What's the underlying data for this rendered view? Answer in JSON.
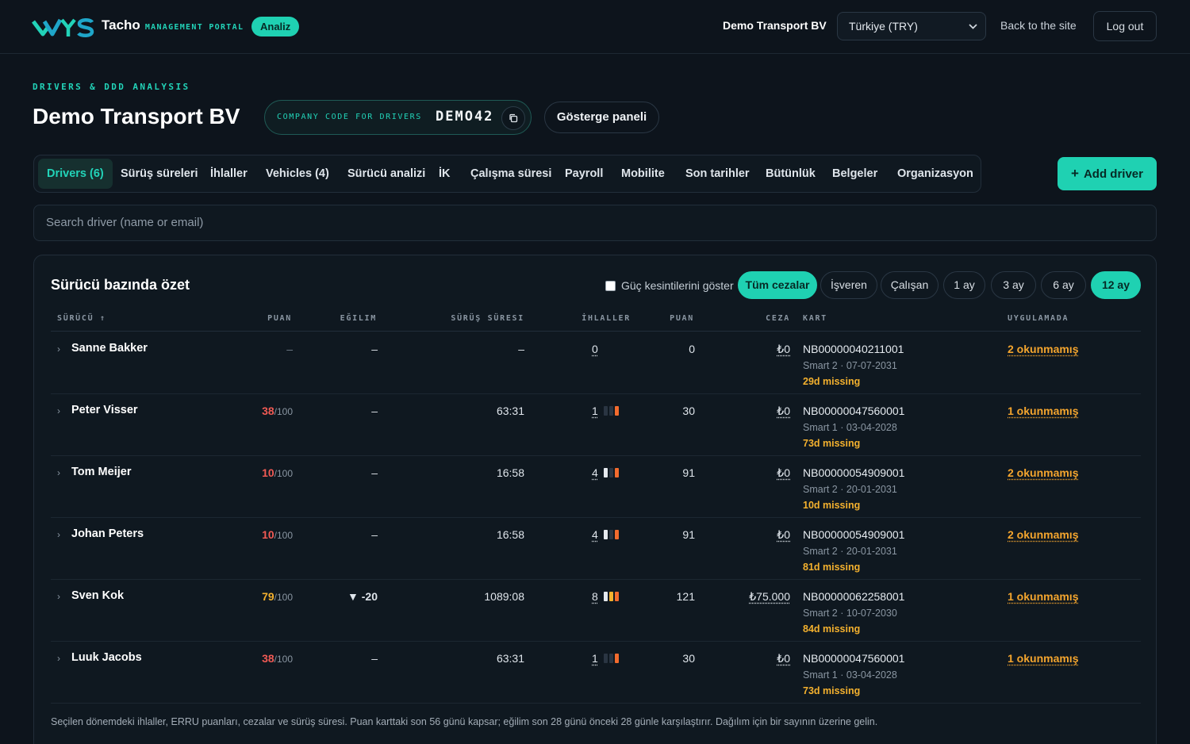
{
  "app": {
    "logo_text": "VYS",
    "brand_main": "Tacho",
    "brand_sub": "MANAGEMENT PORTAL",
    "badge": "Analiz",
    "company": "Demo Transport BV",
    "currency": "Türkiye (TRY)",
    "back_link": "Back to the site",
    "logout": "Log out"
  },
  "header": {
    "kicker": "DRIVERS & DDD ANALYSIS",
    "title": "Demo Transport BV",
    "code_label": "COMPANY CODE FOR DRIVERS",
    "code_value": "DEMO42",
    "dashboard_button": "Gösterge paneli"
  },
  "tabs": [
    {
      "label": "Drivers (6)"
    },
    {
      "label": "Sürüş süreleri"
    },
    {
      "label": "İhlaller"
    },
    {
      "label": "Vehicles (4)"
    },
    {
      "label": "Sürücü analizi"
    },
    {
      "label": "İK"
    },
    {
      "label": "Çalışma süresi"
    },
    {
      "label": "Payroll"
    },
    {
      "label": "Mobilite"
    },
    {
      "label": "Son tarihler"
    },
    {
      "label": "Bütünlük"
    },
    {
      "label": "Belgeler"
    },
    {
      "label": "Organizasyon"
    }
  ],
  "add_driver": "Add driver",
  "search": {
    "placeholder": "Search driver (name or email)"
  },
  "summary": {
    "title": "Sürücü bazında özet",
    "power_checkbox": "Güç kesintilerini göster",
    "filters": [
      "Tüm cezalar",
      "İşveren",
      "Çalışan"
    ],
    "periods": [
      "1 ay",
      "3 ay",
      "6 ay",
      "12 ay"
    ],
    "active_filter": "Tüm cezalar",
    "active_period": "12 ay",
    "columns": {
      "driver": "SÜRÜCÜ ↑",
      "score": "PUAN",
      "trend": "EĞILIM",
      "driving": "SÜRÜŞ SÜRESI",
      "violations": "İHLALLER",
      "points": "PUAN",
      "fine": "CEZA",
      "card": "KART",
      "app": "UYGULAMADA"
    },
    "rows": [
      {
        "name": "Sanne Bakker",
        "score": "",
        "score_den": "",
        "trend": "–",
        "driving": "–",
        "violations": "0",
        "bars": [
          0,
          0,
          0
        ],
        "points": "0",
        "fine": "₺0",
        "card": "NB00000040211001",
        "card_sub": "Smart 2 · 07-07-2031",
        "missing": "29d missing",
        "unread": "2 okunmamış"
      },
      {
        "name": "Peter Visser",
        "score": "38",
        "score_den": "/100",
        "trend": "–",
        "driving": "63:31",
        "violations": "1",
        "bars": [
          0,
          0,
          1
        ],
        "points": "30",
        "fine": "₺0",
        "card": "NB00000047560001",
        "card_sub": "Smart 1 · 03-04-2028",
        "missing": "73d missing",
        "unread": "1 okunmamış"
      },
      {
        "name": "Tom Meijer",
        "score": "10",
        "score_den": "/100",
        "trend": "–",
        "driving": "16:58",
        "violations": "4",
        "bars": [
          1,
          0,
          1
        ],
        "points": "91",
        "fine": "₺0",
        "card": "NB00000054909001",
        "card_sub": "Smart 2 · 20-01-2031",
        "missing": "10d missing",
        "unread": "2 okunmamış"
      },
      {
        "name": "Johan Peters",
        "score": "10",
        "score_den": "/100",
        "trend": "–",
        "driving": "16:58",
        "violations": "4",
        "bars": [
          1,
          0,
          1
        ],
        "points": "91",
        "fine": "₺0",
        "card": "NB00000054909001",
        "card_sub": "Smart 2 · 20-01-2031",
        "missing": "81d missing",
        "unread": "2 okunmamış"
      },
      {
        "name": "Sven Kok",
        "score": "79",
        "score_den": "/100",
        "trend": "▼ -20",
        "driving": "1089:08",
        "violations": "8",
        "bars": [
          1,
          1,
          1
        ],
        "points": "121",
        "fine": "₺75.000",
        "card": "NB00000062258001",
        "card_sub": "Smart 2 · 10-07-2030",
        "missing": "84d missing",
        "unread": "1 okunmamış"
      },
      {
        "name": "Luuk Jacobs",
        "score": "38",
        "score_den": "/100",
        "trend": "–",
        "driving": "63:31",
        "violations": "1",
        "bars": [
          0,
          0,
          1
        ],
        "points": "30",
        "fine": "₺0",
        "card": "NB00000047560001",
        "card_sub": "Smart 1 · 03-04-2028",
        "missing": "73d missing",
        "unread": "1 okunmamış"
      }
    ],
    "footnote": "Seçilen dönemdeki ihlaller, ERRU puanları, cezalar ve sürüş süresi. Puan karttaki son 56 günü kapsar; eğilim son 28 günü önceki 28 günle karşılaştırır. Dağılım için bir sayının üzerine gelin.",
    "colors": {
      "accent": "#1fd1b2",
      "score_low": "#f05a54",
      "score_mid": "#f4b12e",
      "warning": "#f4a52e"
    }
  }
}
